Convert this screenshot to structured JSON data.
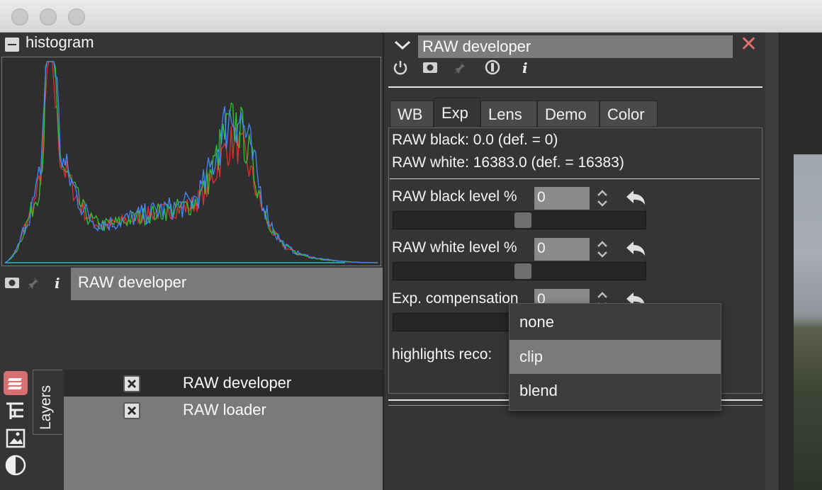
{
  "window": {
    "traffic_lights": [
      "close-light",
      "minimize-light",
      "zoom-light"
    ]
  },
  "histogram": {
    "title": "histogram",
    "series_colors": {
      "red": "#e03030",
      "green": "#30c030",
      "blue": "#4488ff",
      "baseline": "#20c0c0"
    }
  },
  "current_layer": {
    "name": "RAW developer",
    "icons": [
      "snapshot-icon",
      "pin-icon",
      "info-icon"
    ]
  },
  "layers_panel": {
    "tab_label": "Layers",
    "side_icons": [
      "layers-icon",
      "tree-icon",
      "image-icon",
      "contrast-icon"
    ],
    "rows": [
      {
        "label": "RAW developer",
        "selected": true
      },
      {
        "label": "RAW loader",
        "selected": false
      }
    ]
  },
  "module": {
    "title": "RAW developer",
    "close_symbol": "✕",
    "icons": [
      "power-icon",
      "snapshot-icon",
      "pin-icon",
      "opacity-icon",
      "info-icon"
    ],
    "tabs": [
      {
        "label": "WB",
        "active": false
      },
      {
        "label": "Exp",
        "active": true
      },
      {
        "label": "Lens",
        "active": false
      },
      {
        "label": "Demo",
        "active": false
      },
      {
        "label": "Color",
        "active": false
      }
    ],
    "raw_black_info": "RAW black: 0.0 (def. = 0)",
    "raw_white_info": "RAW white: 16383.0 (def. = 16383)",
    "params": [
      {
        "label": "RAW black level %",
        "value": "0",
        "slider_fraction": 0.5
      },
      {
        "label": "RAW white level %",
        "value": "0",
        "slider_fraction": 0.5
      },
      {
        "label": "Exp. compensation",
        "value": "0",
        "slider_fraction": 0.5
      }
    ],
    "highlights_label": "highlights reco:"
  },
  "dropdown": {
    "options": [
      "none",
      "clip",
      "blend"
    ],
    "selected": "clip"
  }
}
